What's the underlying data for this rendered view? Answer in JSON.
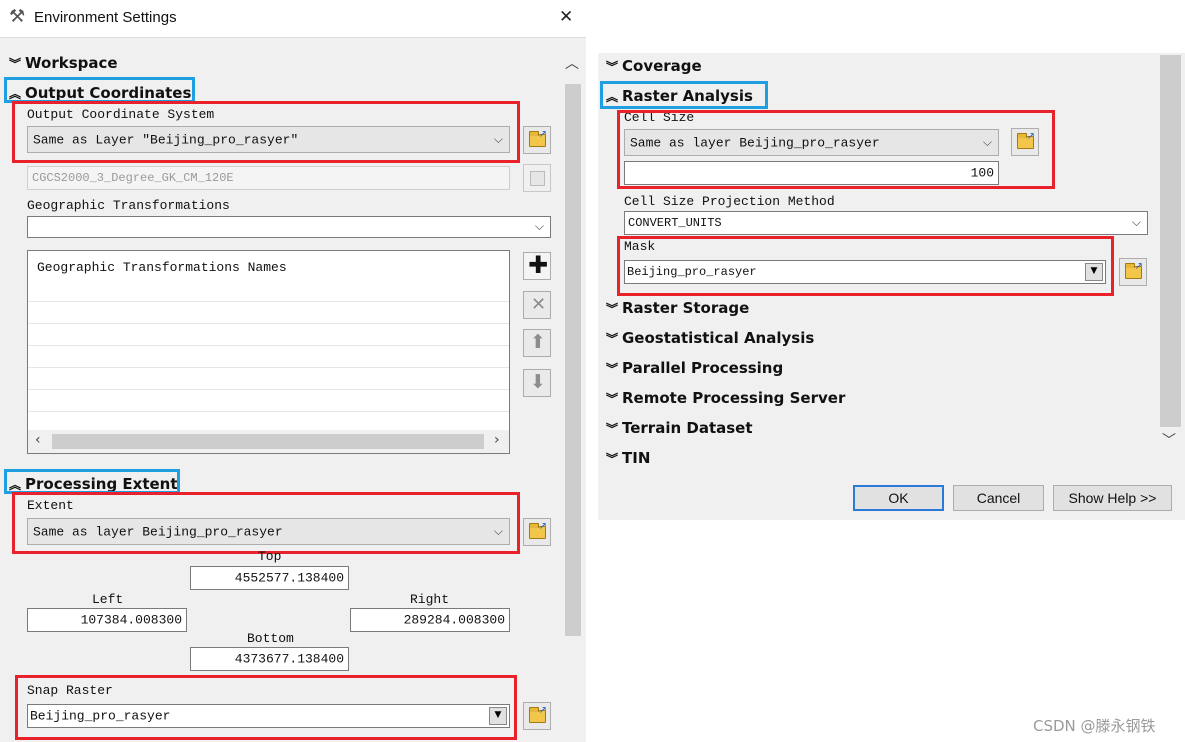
{
  "window": {
    "title": "Environment Settings",
    "close": "✕"
  },
  "left": {
    "workspace": "Workspace",
    "output_coordinates": "Output Coordinates",
    "output_cs_label": "Output Coordinate System",
    "output_cs_value": "Same as Layer \"Beijing_pro_rasyer\"",
    "current_cs": "CGCS2000_3_Degree_GK_CM_120E",
    "geo_trans_label": "Geographic Transformations",
    "geo_trans_value": "",
    "geo_trans_names": "Geographic Transformations Names",
    "processing_extent": "Processing Extent",
    "extent_label": "Extent",
    "extent_value": "Same as layer Beijing_pro_rasyer",
    "top_label": "Top",
    "top_value": "4552577.138400",
    "left_label": "Left",
    "left_value": "107384.008300",
    "right_label": "Right",
    "right_value": "289284.008300",
    "bottom_label": "Bottom",
    "bottom_value": "4373677.138400",
    "snap_label": "Snap Raster",
    "snap_value": "Beijing_pro_rasyer"
  },
  "right": {
    "coverage": "Coverage",
    "raster_analysis": "Raster Analysis",
    "cell_size_label": "Cell Size",
    "cell_size_value": "Same as layer Beijing_pro_rasyer",
    "cell_size_number": "100",
    "cspm_label": "Cell Size Projection Method",
    "cspm_value": "CONVERT_UNITS",
    "mask_label": "Mask",
    "mask_value": "Beijing_pro_rasyer",
    "sections": [
      "Raster Storage",
      "Geostatistical Analysis",
      "Parallel Processing",
      "Remote Processing Server",
      "Terrain Dataset",
      "TIN"
    ],
    "ok": "OK",
    "cancel": "Cancel",
    "show_help": "Show Help >>"
  },
  "watermark": "CSDN @滕永钢铁",
  "colors": {
    "highlight_red": "#e8212b",
    "highlight_blue": "#1f9fe0",
    "panel_bg": "#f0f0f0",
    "accent": "#2a7ad6"
  }
}
